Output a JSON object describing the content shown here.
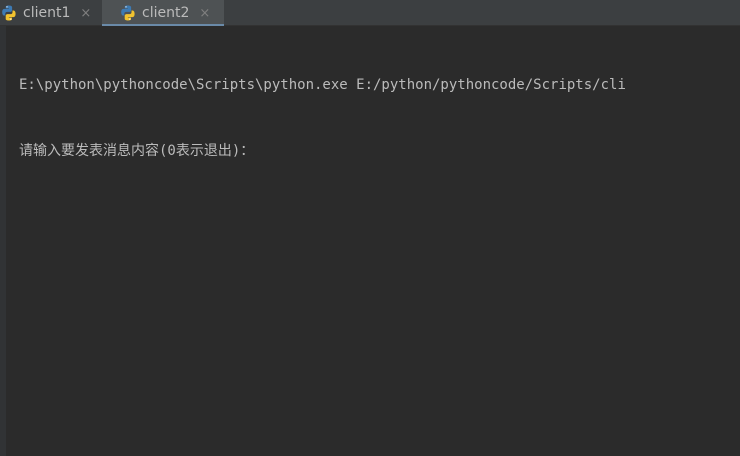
{
  "tabs": [
    {
      "label": "client1",
      "close": "×",
      "active": false,
      "icon": "python-icon"
    },
    {
      "label": "client2",
      "close": "×",
      "active": true,
      "icon": "python-icon"
    }
  ],
  "console": {
    "command_line": "E:\\python\\pythoncode\\Scripts\\python.exe E:/python/pythoncode/Scripts/cli",
    "prompt_line": "请输入要发表消息内容(0表示退出)："
  },
  "colors": {
    "background": "#2b2b2b",
    "tabbar": "#3c3f41",
    "active_tab": "#4e5254",
    "active_underline": "#6a8aa8",
    "text": "#bbbbbb"
  }
}
